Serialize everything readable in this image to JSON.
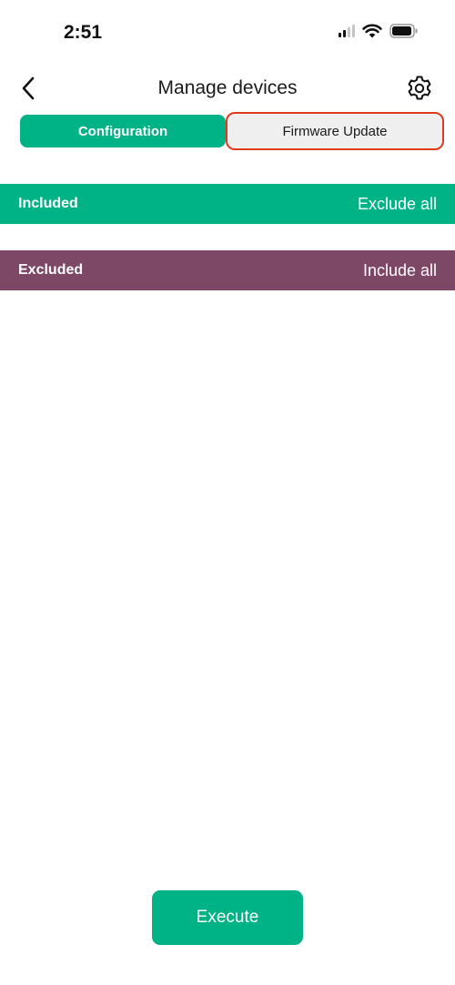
{
  "status_bar": {
    "time": "2:51"
  },
  "header": {
    "title": "Manage devices",
    "back_icon": "chevron-left-icon",
    "settings_icon": "gear-icon"
  },
  "tabs": [
    {
      "label": "Configuration",
      "selected": true
    },
    {
      "label": "Firmware Update",
      "selected": false
    }
  ],
  "sections": {
    "included": {
      "label": "Included",
      "action": "Exclude all"
    },
    "excluded": {
      "label": "Excluded",
      "action": "Include all"
    }
  },
  "footer": {
    "execute_label": "Execute"
  },
  "colors": {
    "accent_green": "#00b386",
    "excluded_purple": "#7d4766",
    "highlight_red": "#e03a1e"
  }
}
